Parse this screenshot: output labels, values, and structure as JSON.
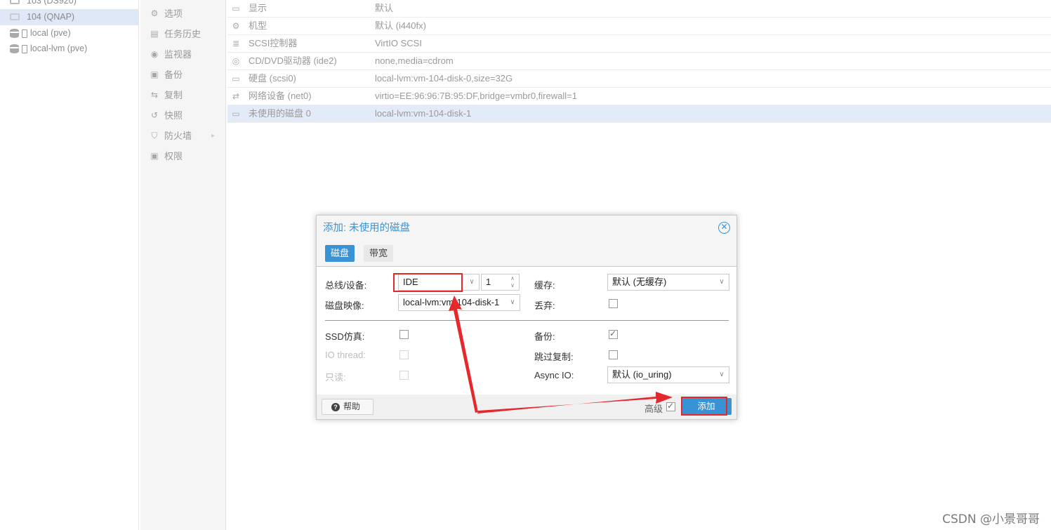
{
  "tree": {
    "items": [
      {
        "label": "103 (DS920)",
        "type": "vm"
      },
      {
        "label": "104 (QNAP)",
        "type": "vm",
        "selected": true
      },
      {
        "label": "local (pve)",
        "type": "storage"
      },
      {
        "label": "local-lvm (pve)",
        "type": "storage"
      }
    ]
  },
  "menu": {
    "items": [
      {
        "label": "选项",
        "icon": "gear-icon",
        "glyph": "⚙"
      },
      {
        "label": "任务历史",
        "icon": "list-icon",
        "glyph": "▤"
      },
      {
        "label": "监视器",
        "icon": "eye-icon",
        "glyph": "◉"
      },
      {
        "label": "备份",
        "icon": "floppy-icon",
        "glyph": "▣"
      },
      {
        "label": "复制",
        "icon": "retweet-icon",
        "glyph": "⇆"
      },
      {
        "label": "快照",
        "icon": "history-icon",
        "glyph": "↺"
      },
      {
        "label": "防火墙",
        "icon": "shield-icon",
        "glyph": "⛉",
        "arrow": "▸"
      },
      {
        "label": "权限",
        "icon": "unlock-icon",
        "glyph": "🔓"
      }
    ]
  },
  "hardware": {
    "rows": [
      {
        "key": "显示",
        "value": "默认",
        "icon": "monitor-icon",
        "glyph": "▭"
      },
      {
        "key": "机型",
        "value": "默认 (i440fx)",
        "icon": "cogs-icon",
        "glyph": "⚙"
      },
      {
        "key": "SCSI控制器",
        "value": "VirtIO SCSI",
        "icon": "database-icon",
        "glyph": "≣"
      },
      {
        "key": "CD/DVD驱动器 (ide2)",
        "value": "none,media=cdrom",
        "icon": "cdrom-icon",
        "glyph": "◎"
      },
      {
        "key": "硬盘 (scsi0)",
        "value": "local-lvm:vm-104-disk-0,size=32G",
        "icon": "hdd-icon",
        "glyph": "▭"
      },
      {
        "key": "网络设备 (net0)",
        "value": "virtio=EE:96:96:7B:95:DF,bridge=vmbr0,firewall=1",
        "icon": "exchange-icon",
        "glyph": "⇄"
      },
      {
        "key": "未使用的磁盘 0",
        "value": "local-lvm:vm-104-disk-1",
        "icon": "hdd-icon",
        "glyph": "▭",
        "selected": true
      }
    ]
  },
  "dialog": {
    "title": "添加: 未使用的磁盘",
    "tabs": [
      "磁盘",
      "带宽"
    ],
    "bus_label": "总线/设备:",
    "bus_value": "IDE",
    "device_number": "1",
    "image_label": "磁盘映像:",
    "image_value": "local-lvm:vm-104-disk-1",
    "cache_label": "缓存:",
    "cache_value": "默认 (无缓存)",
    "discard_label": "丢弃:",
    "ssd_label": "SSD仿真:",
    "iothread_label": "IO thread:",
    "readonly_label": "只读:",
    "backup_label": "备份:",
    "skip_replication_label": "跳过复制:",
    "async_io_label": "Async IO:",
    "async_io_value": "默认 (io_uring)",
    "help_label": "帮助",
    "advanced_label": "高级",
    "add_label": "添加"
  },
  "watermark": "CSDN @小景哥哥",
  "colors": {
    "accent": "#3892d4",
    "annotation_red": "#e5282b",
    "selection": "#e2ebf7"
  }
}
